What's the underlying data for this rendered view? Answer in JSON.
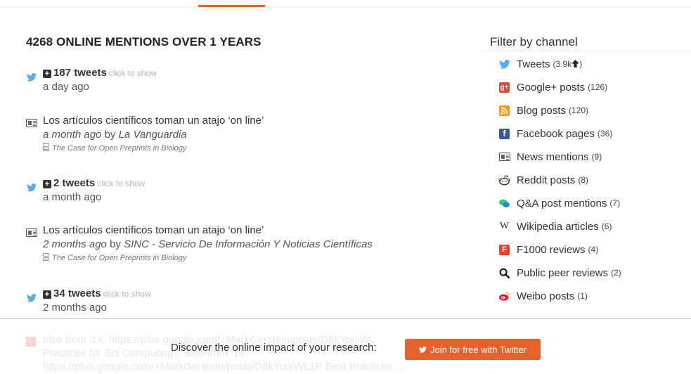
{
  "header": {
    "active_tab_color": "#e8612c"
  },
  "mentions_heading": "4268 ONLINE MENTIONS OVER 1 YEARS",
  "mentions": [
    {
      "type": "tweets",
      "icon": "twitter-icon",
      "count_label": "187 tweets",
      "hint": "click to show",
      "time": "a day ago"
    },
    {
      "type": "news",
      "icon": "news-icon",
      "title": "Los artículos científicos toman un atajo ‘on line’",
      "time": "a month ago",
      "by": "by",
      "source": "La Vanguardia",
      "paper": "The Case for Open Preprints in Biology"
    },
    {
      "type": "tweets",
      "icon": "twitter-icon",
      "count_label": "2 tweets",
      "hint": "click to show",
      "time": "a month ago"
    },
    {
      "type": "news",
      "icon": "news-icon",
      "title": "Los artículos científicos toman un atajo ‘on line’",
      "time": "2 months ago",
      "by": "by",
      "source": "SINC - Servicio De Información Y Noticias Científicas",
      "paper": "The Case for Open Preprints in Biology"
    },
    {
      "type": "tweets",
      "icon": "twitter-icon",
      "count_label": "34 tweets",
      "hint": "click to show",
      "time": "2 months ago"
    }
  ],
  "faded_mention": {
    "line1": "also from '14: https://plus.google.com/+MarkGerstein/posts/D8kYoqiWL",
    "line2": "Practices for Sci Computing... also from '14:",
    "line3": "https://plus.google.com/+MarkGerstein/posts/D8kYoqiWL1P Best Practices ..."
  },
  "sidebar": {
    "title": "Filter by channel",
    "channels": [
      {
        "label": "Tweets",
        "count": "(3.9k",
        "count_suffix": ")",
        "icon": "twitter-icon",
        "color": "#55acee"
      },
      {
        "label": "Google+ posts",
        "count": "(126)",
        "icon": "google-plus-icon",
        "color": "#dd4b39"
      },
      {
        "label": "Blog posts",
        "count": "(120)",
        "icon": "rss-icon",
        "color": "#f39c12"
      },
      {
        "label": "Facebook pages",
        "count": "(36)",
        "icon": "facebook-icon",
        "color": "#3b5998"
      },
      {
        "label": "News mentions",
        "count": "(9)",
        "icon": "news-icon",
        "color": "#555555"
      },
      {
        "label": "Reddit posts",
        "count": "(8)",
        "icon": "reddit-icon",
        "color": "#ff4500"
      },
      {
        "label": "Q&A post mentions",
        "count": "(7)",
        "icon": "qa-icon",
        "color": "#2ecc71"
      },
      {
        "label": "Wikipedia articles",
        "count": "(6)",
        "icon": "wikipedia-icon",
        "color": "#333333"
      },
      {
        "label": "F1000 reviews",
        "count": "(4)",
        "icon": "f1000-icon",
        "color": "#e8412c"
      },
      {
        "label": "Public peer reviews",
        "count": "(2)",
        "icon": "search-icon",
        "color": "#222222"
      },
      {
        "label": "Weibo posts",
        "count": "(1)",
        "icon": "weibo-icon",
        "color": "#e6162d"
      }
    ]
  },
  "footer_banner": {
    "text": "Discover the online impact of your research:",
    "button_label": "Join for free with Twitter",
    "button_color": "#e8612c"
  }
}
